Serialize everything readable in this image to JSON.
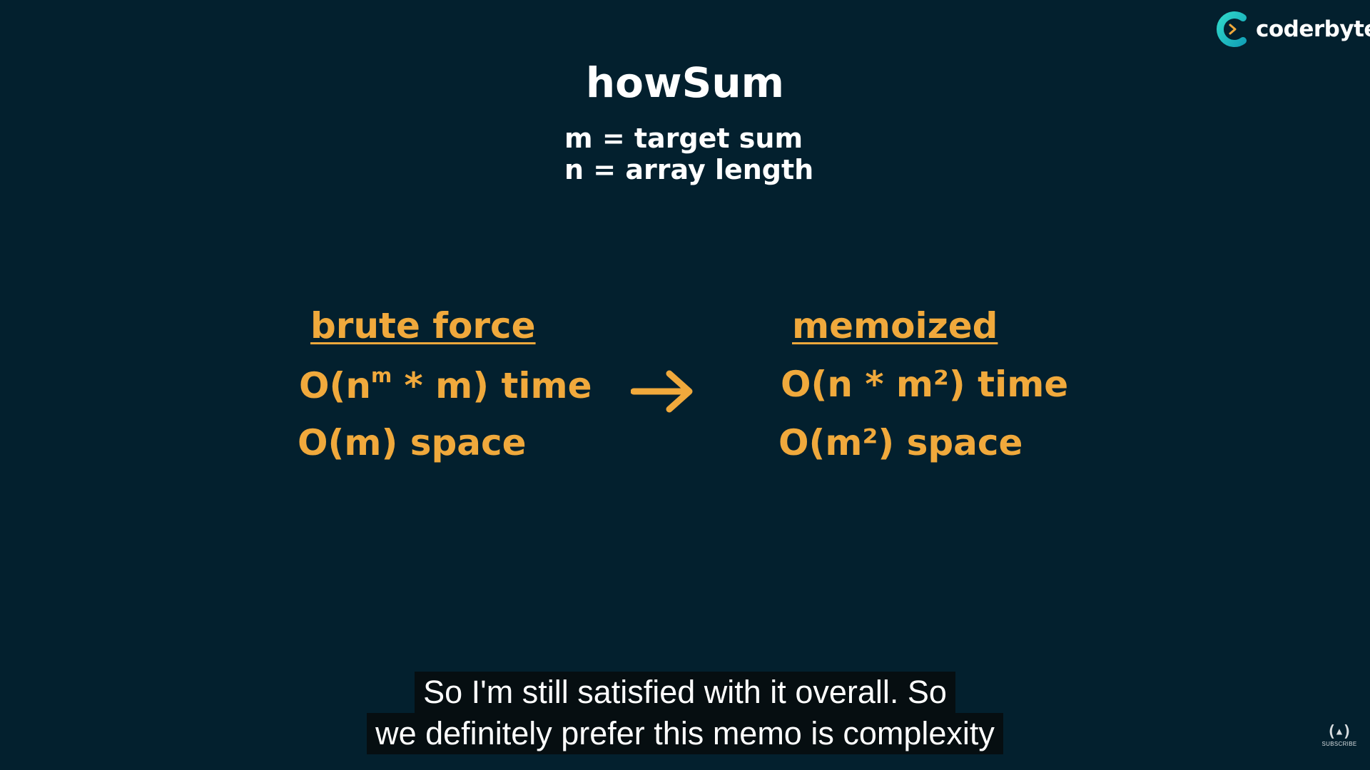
{
  "slide": {
    "title": "howSum",
    "definitions": [
      "m = target sum",
      "n = array length"
    ],
    "brute_force": {
      "heading": "brute force",
      "time_prefix": "O(n",
      "time_sup": "m",
      "time_suffix": " * m) time",
      "space": "O(m) space"
    },
    "memoized": {
      "heading": "memoized",
      "time": "O(n * m²) time",
      "space": "O(m²) space"
    },
    "arrow_icon": "right-arrow-icon"
  },
  "brand": {
    "logo_text": "coderbyte",
    "logo_icon": "coderbyte-c-logo-icon"
  },
  "captions": [
    "So I'm still satisfied with it overall. So",
    "we definitely prefer this memo is complexity"
  ],
  "watermark": {
    "glyph": "(🔥)",
    "label": "SUBSCRIBE"
  },
  "colors": {
    "background": "#03202e",
    "accent": "#f0a93c",
    "text": "#ffffff",
    "logo_teal": "#1ec4c4"
  }
}
